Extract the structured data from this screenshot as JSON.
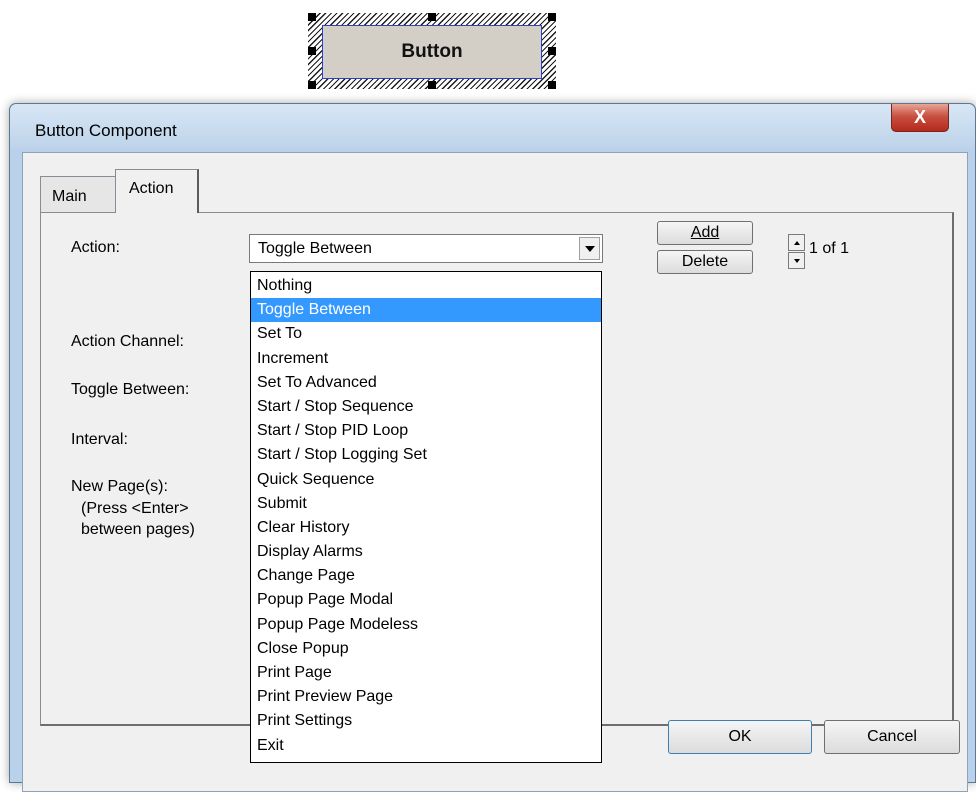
{
  "design_button": {
    "label": "Button"
  },
  "window": {
    "title": "Button Component",
    "close_label": "X"
  },
  "tabs": [
    {
      "label": "Main",
      "active": false
    },
    {
      "label": "Action",
      "active": true
    }
  ],
  "fields": {
    "action_label": "Action:",
    "action_channel_label": "Action Channel:",
    "toggle_between_label": "Toggle Between:",
    "interval_label": "Interval:",
    "new_pages_label": "New Page(s):",
    "new_pages_hint_1": "(Press <Enter>",
    "new_pages_hint_2": "between pages)"
  },
  "action_combo": {
    "value": "Toggle Between",
    "expanded": true,
    "options": [
      "Nothing",
      "Toggle Between",
      "Set To",
      "Increment",
      "Set To Advanced",
      "Start / Stop Sequence",
      "Start / Stop PID Loop",
      "Start / Stop Logging Set",
      "Quick Sequence",
      "Submit",
      "Clear History",
      "Display Alarms",
      "Change Page",
      "Popup Page Modal",
      "Popup Page Modeless",
      "Close Popup",
      "Print Page",
      "Print Preview Page",
      "Print Settings",
      "Exit"
    ],
    "selected_index": 1
  },
  "action_buttons": {
    "add_label": "Add",
    "delete_label": "Delete",
    "counter": "1 of 1"
  },
  "dialog_buttons": {
    "ok_label": "OK",
    "cancel_label": "Cancel"
  },
  "colors": {
    "selection_highlight": "#3399ff",
    "window_frame": "#b9d1ea",
    "close_button": "#c75141",
    "design_button_face": "#d4cfc6"
  }
}
